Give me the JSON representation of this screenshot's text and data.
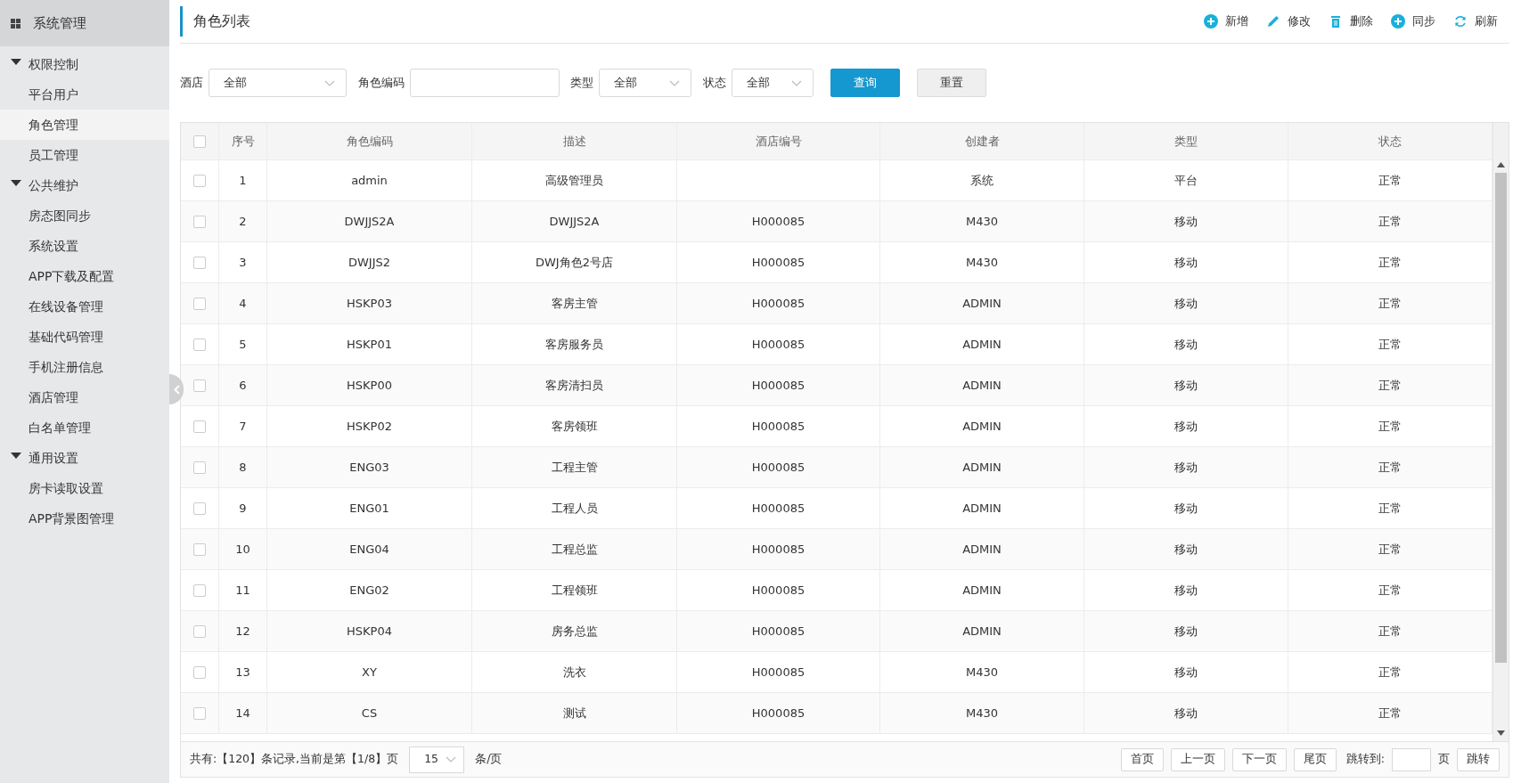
{
  "sidebar": {
    "title": "系统管理",
    "groups": [
      {
        "label": "权限控制",
        "expanded": true,
        "items": [
          {
            "label": "平台用户",
            "selected": false
          },
          {
            "label": "角色管理",
            "selected": true
          },
          {
            "label": "员工管理",
            "selected": false
          }
        ]
      },
      {
        "label": "公共维护",
        "expanded": true,
        "items": [
          {
            "label": "房态图同步",
            "selected": false
          },
          {
            "label": "系统设置",
            "selected": false
          },
          {
            "label": "APP下载及配置",
            "selected": false
          },
          {
            "label": "在线设备管理",
            "selected": false
          },
          {
            "label": "基础代码管理",
            "selected": false
          },
          {
            "label": "手机注册信息",
            "selected": false
          },
          {
            "label": "酒店管理",
            "selected": false
          },
          {
            "label": "白名单管理",
            "selected": false
          }
        ]
      },
      {
        "label": "通用设置",
        "expanded": true,
        "items": [
          {
            "label": "房卡读取设置",
            "selected": false
          },
          {
            "label": "APP背景图管理",
            "selected": false
          }
        ]
      }
    ]
  },
  "page_title": "角色列表",
  "toolbar": [
    {
      "label": "新增",
      "kind": "add"
    },
    {
      "label": "修改",
      "kind": "edit"
    },
    {
      "label": "删除",
      "kind": "delete"
    },
    {
      "label": "同步",
      "kind": "sync"
    },
    {
      "label": "刷新",
      "kind": "refresh"
    }
  ],
  "filters": [
    {
      "kind": "select",
      "label": "酒店",
      "value": "全部"
    },
    {
      "kind": "text",
      "label": "角色编码"
    },
    {
      "kind": "select",
      "label": "类型",
      "value": "全部"
    },
    {
      "kind": "select",
      "label": "状态",
      "value": "全部"
    }
  ],
  "buttons": [
    {
      "label": "查询",
      "kind": "primary"
    },
    {
      "label": "重置",
      "kind": "secondary"
    }
  ],
  "table": {
    "header_checked": false,
    "columns": [
      "序号",
      "角色编码",
      "描述",
      "酒店编号",
      "创建者",
      "类型",
      "状态"
    ],
    "rows": [
      {
        "checked": false,
        "cells": [
          "1",
          "admin",
          "高级管理员",
          null,
          "系统",
          "平台",
          "正常"
        ]
      },
      {
        "checked": false,
        "cells": [
          "2",
          "DWJJS2A",
          "DWJJS2A",
          "H000085",
          "M430",
          "移动",
          "正常"
        ]
      },
      {
        "checked": false,
        "cells": [
          "3",
          "DWJJS2",
          "DWJ角色2号店",
          "H000085",
          "M430",
          "移动",
          "正常"
        ]
      },
      {
        "checked": false,
        "cells": [
          "4",
          "HSKP03",
          "客房主管",
          "H000085",
          "ADMIN",
          "移动",
          "正常"
        ]
      },
      {
        "checked": false,
        "cells": [
          "5",
          "HSKP01",
          "客房服务员",
          "H000085",
          "ADMIN",
          "移动",
          "正常"
        ]
      },
      {
        "checked": false,
        "cells": [
          "6",
          "HSKP00",
          "客房清扫员",
          "H000085",
          "ADMIN",
          "移动",
          "正常"
        ]
      },
      {
        "checked": false,
        "cells": [
          "7",
          "HSKP02",
          "客房领班",
          "H000085",
          "ADMIN",
          "移动",
          "正常"
        ]
      },
      {
        "checked": false,
        "cells": [
          "8",
          "ENG03",
          "工程主管",
          "H000085",
          "ADMIN",
          "移动",
          "正常"
        ]
      },
      {
        "checked": false,
        "cells": [
          "9",
          "ENG01",
          "工程人员",
          "H000085",
          "ADMIN",
          "移动",
          "正常"
        ]
      },
      {
        "checked": false,
        "cells": [
          "10",
          "ENG04",
          "工程总监",
          "H000085",
          "ADMIN",
          "移动",
          "正常"
        ]
      },
      {
        "checked": false,
        "cells": [
          "11",
          "ENG02",
          "工程领班",
          "H000085",
          "ADMIN",
          "移动",
          "正常"
        ]
      },
      {
        "checked": false,
        "cells": [
          "12",
          "HSKP04",
          "房务总监",
          "H000085",
          "ADMIN",
          "移动",
          "正常"
        ]
      },
      {
        "checked": false,
        "cells": [
          "13",
          "XY",
          "洗衣",
          "H000085",
          "M430",
          "移动",
          "正常"
        ]
      },
      {
        "checked": false,
        "cells": [
          "14",
          "CS",
          "测试",
          "H000085",
          "M430",
          "移动",
          "正常"
        ]
      }
    ]
  },
  "pagination": {
    "summary": "共有:【120】条记录,当前是第【1/8】页",
    "page_size": "15",
    "page_size_unit": "条/页",
    "buttons": [
      "首页",
      "上一页",
      "下一页",
      "尾页"
    ],
    "jump_label": "跳转到:",
    "jump_unit": "页",
    "jump_button": "跳转"
  }
}
